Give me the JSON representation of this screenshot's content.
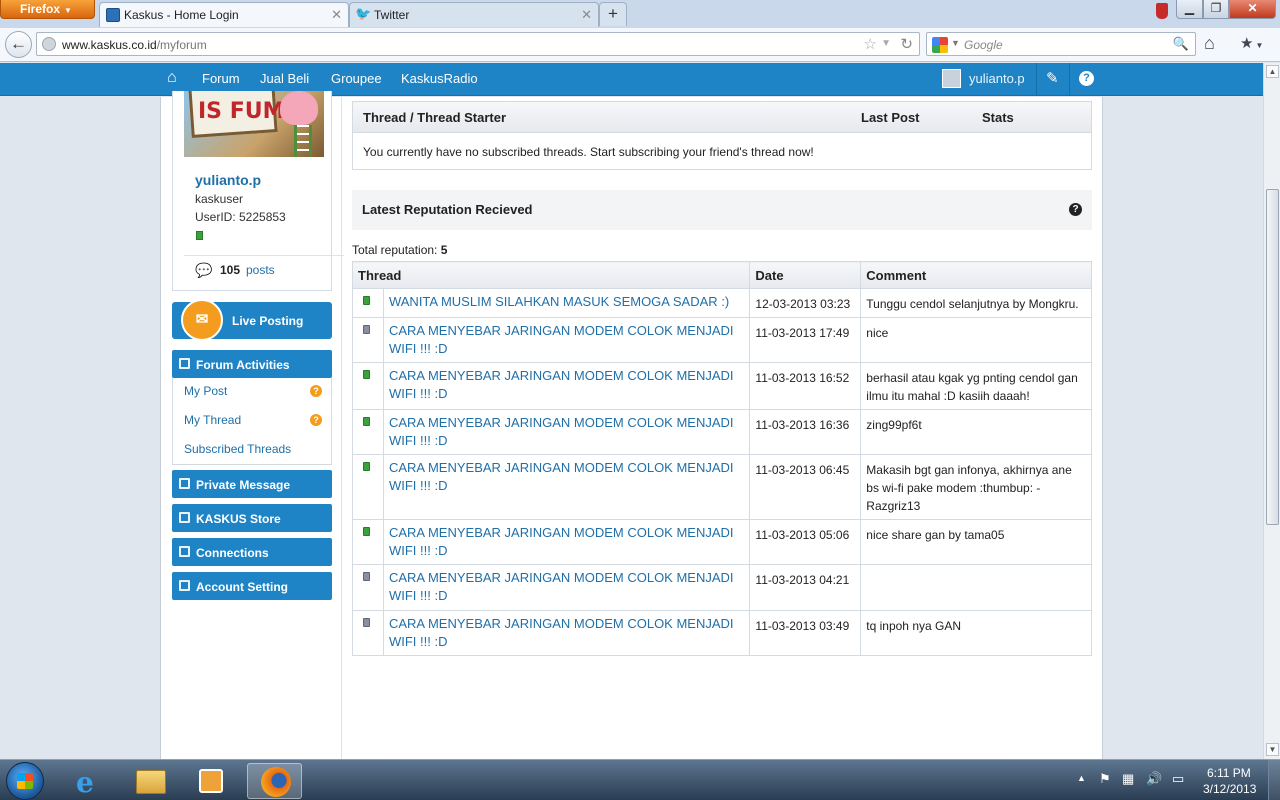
{
  "browser": {
    "menu_label": "Firefox",
    "tabs": [
      {
        "title": "Kaskus - Home Login"
      },
      {
        "title": "Twitter"
      }
    ],
    "new_tab_label": "+",
    "url_host": "www.kaskus.co.id",
    "url_path": "/myforum",
    "search_placeholder": "Google"
  },
  "site_nav": {
    "items": [
      "Forum",
      "Jual Beli",
      "Groupee",
      "KaskusRadio"
    ],
    "username": "yulianto.p"
  },
  "profile": {
    "image_text": "IS FUM!",
    "name": "yulianto.p",
    "rank": "kaskuser",
    "user_id": "UserID: 5225853",
    "post_count": "105",
    "post_label": "posts"
  },
  "sidebar": {
    "live_posting": "Live Posting",
    "forum_activities": "Forum Activities",
    "forum_items": [
      "My Post",
      "My Thread",
      "Subscribed Threads"
    ],
    "private_message": "Private Message",
    "store": "KASKUS Store",
    "connections": "Connections",
    "account_setting": "Account Setting"
  },
  "subscribed": {
    "col_thread": "Thread / Thread Starter",
    "col_last_post": "Last Post",
    "col_stats": "Stats",
    "empty_message": "You currently have no subscribed threads. Start subscribing your friend's thread now!"
  },
  "reputation": {
    "title": "Latest Reputation Recieved",
    "total_label": "Total reputation:",
    "total_value": "5",
    "col_thread": "Thread",
    "col_date": "Date",
    "col_comment": "Comment",
    "rows": [
      {
        "status": "positive",
        "thread": "WANITA MUSLIM SILAHKAN MASUK SEMOGA SADAR :)",
        "date": "12-03-2013 03:23",
        "comment": "Tunggu cendol selanjutnya by Mongkru."
      },
      {
        "status": "neutral",
        "thread": "CARA MENYEBAR JARINGAN MODEM COLOK MENJADI WIFI !!! :D",
        "date": "11-03-2013 17:49",
        "comment": "nice"
      },
      {
        "status": "positive",
        "thread": "CARA MENYEBAR JARINGAN MODEM COLOK MENJADI WIFI !!! :D",
        "date": "11-03-2013 16:52",
        "comment": "berhasil atau kgak yg pnting cendol gan ilmu itu mahal :D kasiih daaah!"
      },
      {
        "status": "positive",
        "thread": "CARA MENYEBAR JARINGAN MODEM COLOK MENJADI WIFI !!! :D",
        "date": "11-03-2013 16:36",
        "comment": "zing99pf6t"
      },
      {
        "status": "positive",
        "thread": "CARA MENYEBAR JARINGAN MODEM COLOK MENJADI WIFI !!! :D",
        "date": "11-03-2013 06:45",
        "comment": "Makasih bgt gan infonya, akhirnya ane bs wi-fi pake modem :thumbup: -Razgriz13"
      },
      {
        "status": "positive",
        "thread": "CARA MENYEBAR JARINGAN MODEM COLOK MENJADI WIFI !!! :D",
        "date": "11-03-2013 05:06",
        "comment": "nice share gan by tama05"
      },
      {
        "status": "neutral",
        "thread": "CARA MENYEBAR JARINGAN MODEM COLOK MENJADI WIFI !!! :D",
        "date": "11-03-2013 04:21",
        "comment": ""
      },
      {
        "status": "neutral",
        "thread": "CARA MENYEBAR JARINGAN MODEM COLOK MENJADI WIFI !!! :D",
        "date": "11-03-2013 03:49",
        "comment": "tq inpoh nya GAN"
      }
    ]
  },
  "taskbar": {
    "time": "6:11 PM",
    "date": "3/12/2013"
  },
  "colors": {
    "brand_blue": "#1f84c6",
    "link_blue": "#1f6fa8",
    "positive_rep": "#3aa23a",
    "neutral_rep": "#8b8fa2",
    "badge_orange": "#f39c1d"
  }
}
